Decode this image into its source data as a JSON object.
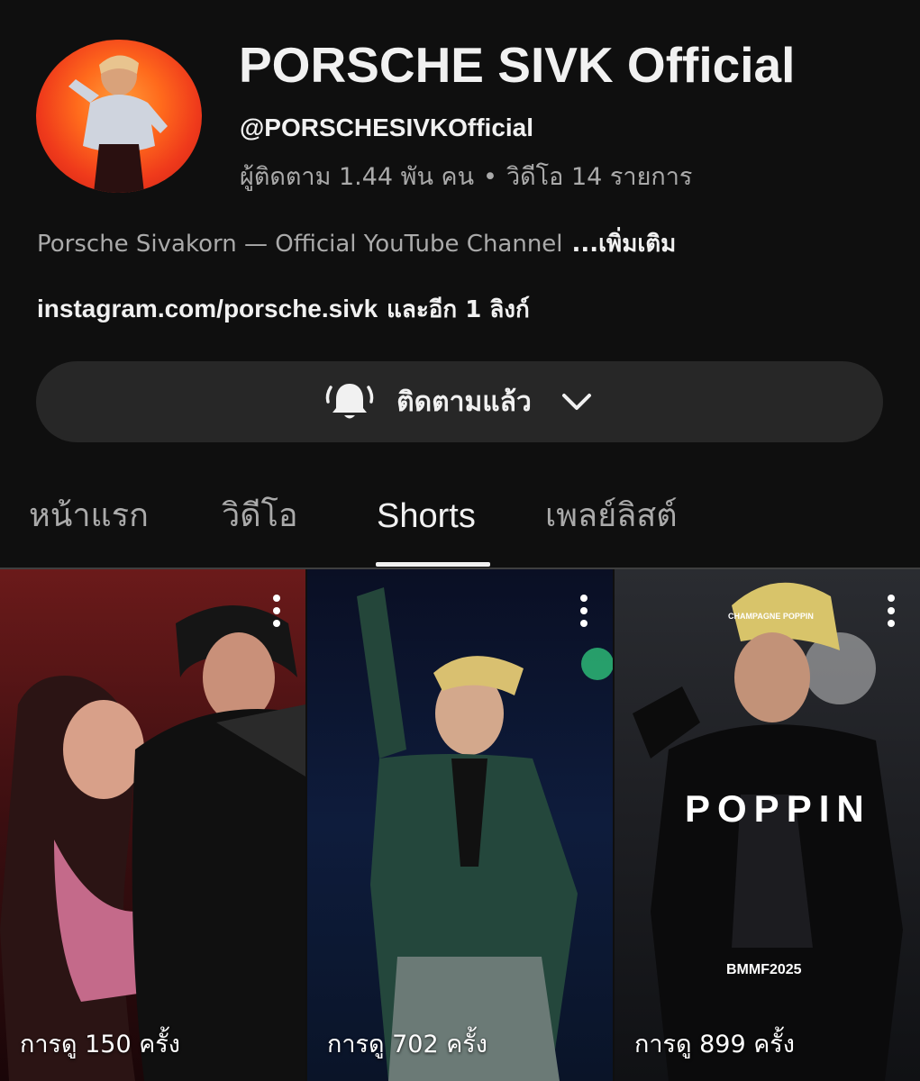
{
  "channel": {
    "title": "PORSCHE SIVK Official",
    "handle": "@PORSCHESIVKOfficial",
    "subscribers": "ผู้ติดตาม 1.44 พัน คน",
    "separator": "•",
    "videos": "วิดีโอ 14 รายการ",
    "description": "Porsche Sivakorn — Official YouTube Channel",
    "more_label": "...เพิ่มเติม",
    "link": "instagram.com/porsche.sivk",
    "link_extra": "และอีก 1 ลิงก์"
  },
  "subscribe": {
    "label": "ติดตามแล้ว",
    "icon": "bell-icon",
    "dropdown_icon": "chevron-down-icon"
  },
  "tabs": [
    {
      "label": "หน้าแรก",
      "active": false
    },
    {
      "label": "วิดีโอ",
      "active": false
    },
    {
      "label": "Shorts",
      "active": true
    },
    {
      "label": "เพลย์ลิสต์",
      "active": false
    }
  ],
  "shorts": [
    {
      "views": "การดู 150 ครั้ง"
    },
    {
      "views": "การดู 702 ครั้ง"
    },
    {
      "views": "การดู 899 ครั้ง",
      "overlay_small": "CHAMPAGNE POPPIN",
      "overlay_title": "POPPIN",
      "overlay_footer": "BMMF2025"
    }
  ],
  "colors": {
    "background": "#0f0f0f",
    "button_bg": "#272727",
    "text_primary": "#f1f1f1",
    "text_secondary": "#aaaaaa"
  }
}
